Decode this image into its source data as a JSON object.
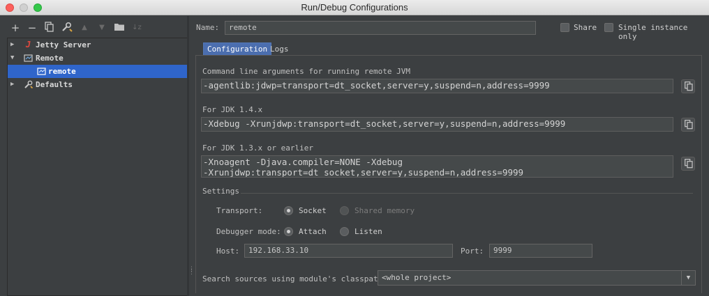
{
  "window": {
    "title": "Run/Debug Configurations"
  },
  "toolbar": {
    "add": "+",
    "remove": "−"
  },
  "tree": {
    "items": [
      {
        "label": "Jetty Server",
        "expanded": false,
        "selected": false,
        "level": 0
      },
      {
        "label": "Remote",
        "expanded": true,
        "selected": false,
        "level": 0
      },
      {
        "label": "remote",
        "selected": true,
        "level": 1
      },
      {
        "label": "Defaults",
        "expanded": false,
        "selected": false,
        "level": 0
      }
    ]
  },
  "header": {
    "name_label": "Name:",
    "name_value": "remote",
    "share_label": "Share",
    "share_checked": false,
    "single_instance_label": "Single instance only",
    "single_instance_checked": false
  },
  "tabs": [
    {
      "label": "Configuration",
      "active": true
    },
    {
      "label": "Logs",
      "active": false
    }
  ],
  "config": {
    "cmd_label": "Command line arguments for running remote JVM",
    "cmd_value": "-agentlib:jdwp=transport=dt_socket,server=y,suspend=n,address=9999",
    "jdk14_label": "For JDK 1.4.x",
    "jdk14_value": "-Xdebug -Xrunjdwp:transport=dt_socket,server=y,suspend=n,address=9999",
    "jdk13_label": "For JDK 1.3.x or earlier",
    "jdk13_value": "-Xnoagent -Djava.compiler=NONE -Xdebug\n-Xrunjdwp:transport=dt_socket,server=y,suspend=n,address=9999",
    "settings_label": "Settings",
    "transport_label": "Transport:",
    "transport_socket": "Socket",
    "transport_shared": "Shared memory",
    "transport_selected": "Socket",
    "mode_label": "Debugger mode:",
    "mode_attach": "Attach",
    "mode_listen": "Listen",
    "mode_selected": "Attach",
    "host_label": "Host:",
    "host_value": "192.168.33.10",
    "port_label": "Port:",
    "port_value": "9999",
    "classpath_label": "Search sources using module's classpath:",
    "classpath_value": "<whole project>"
  },
  "colors": {
    "background": "#3c3f41",
    "selection": "#2f65ca",
    "active_tab": "#4b6eaf"
  }
}
